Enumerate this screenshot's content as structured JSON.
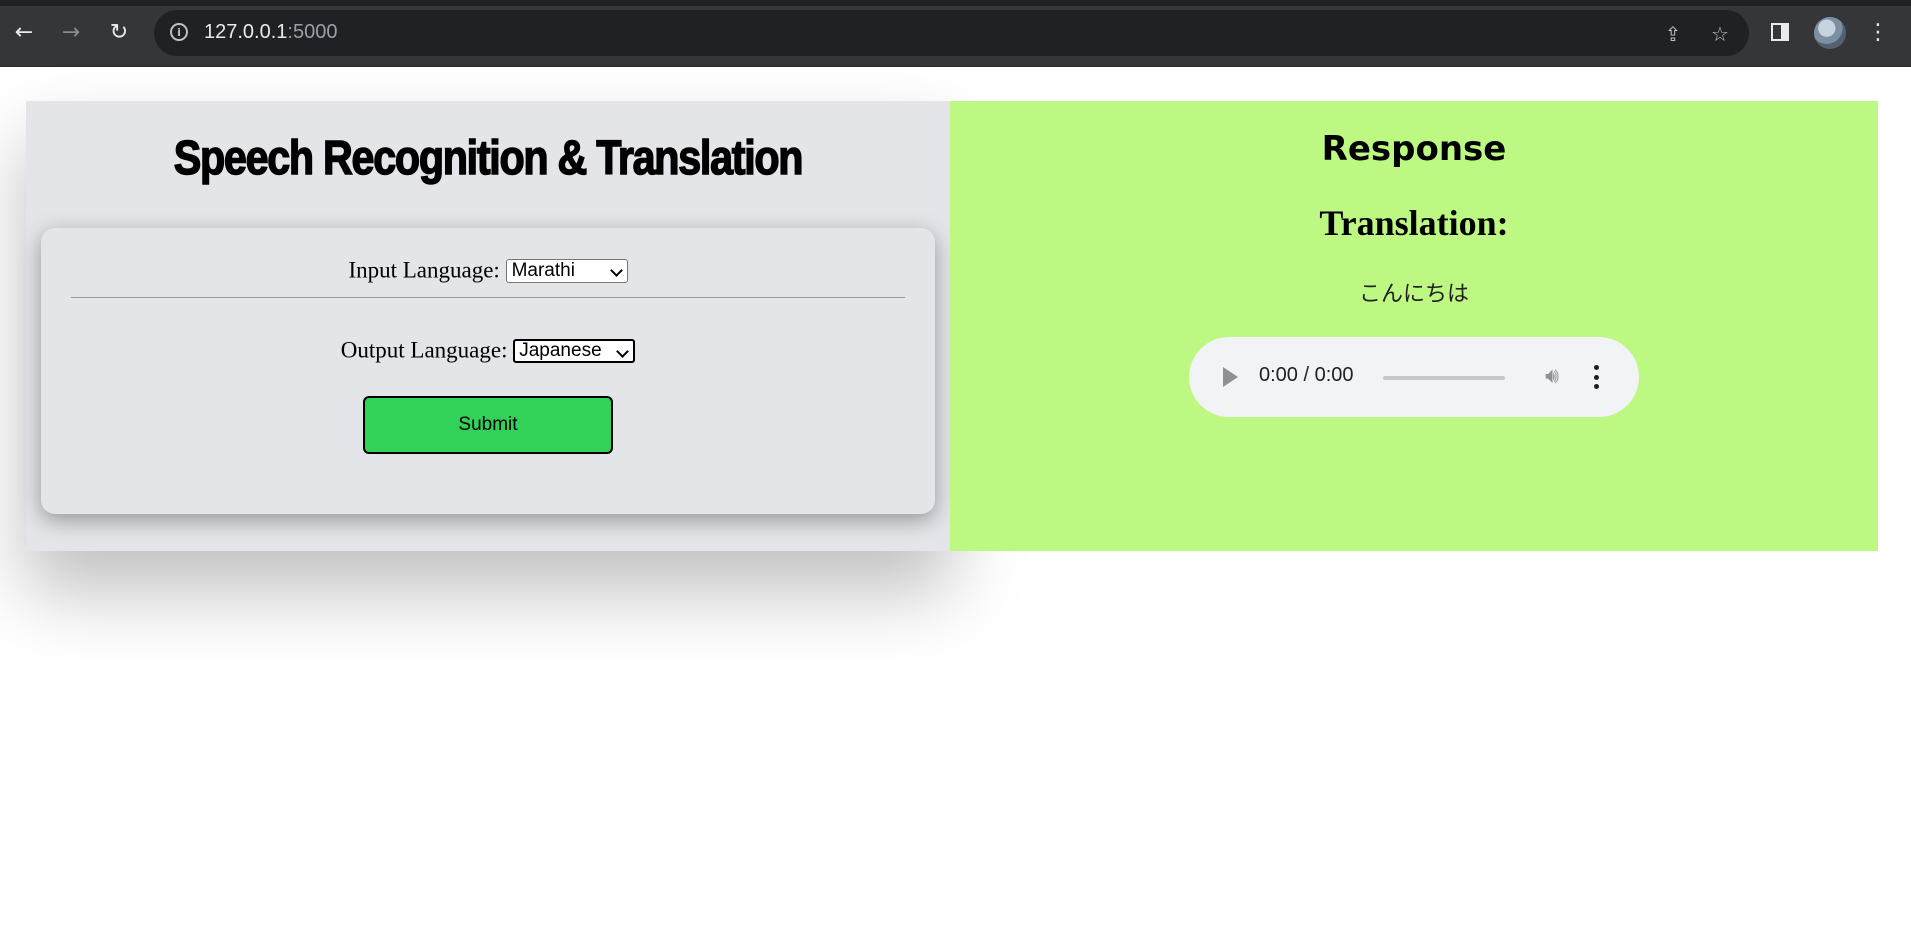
{
  "browser": {
    "url_host": "127.0.0.1",
    "url_port": ":5000",
    "icons": {
      "back": "arrow-left-icon",
      "forward": "arrow-right-icon",
      "reload": "reload-icon",
      "site_info": "info-icon",
      "share": "share-icon",
      "bookmark": "star-icon",
      "side_panel": "side-panel-icon",
      "profile": "avatar",
      "menu": "kebab-menu-icon"
    }
  },
  "app": {
    "title": "Speech Recognition & Translation"
  },
  "form": {
    "input_label": "Input Language:",
    "input_value": "Marathi",
    "output_label": "Output Language:",
    "output_value": "Japanese",
    "submit_label": "Submit"
  },
  "response": {
    "title": "Response",
    "translation_heading": "Translation:",
    "translation_text": "こんにちは",
    "audio": {
      "time": "0:00 / 0:00",
      "progress": 0
    }
  },
  "colors": {
    "left_panel_bg": "#e4e5e8",
    "right_panel_bg": "#bdf882",
    "submit_bg": "#32d158",
    "chrome_bg": "#35363a"
  }
}
